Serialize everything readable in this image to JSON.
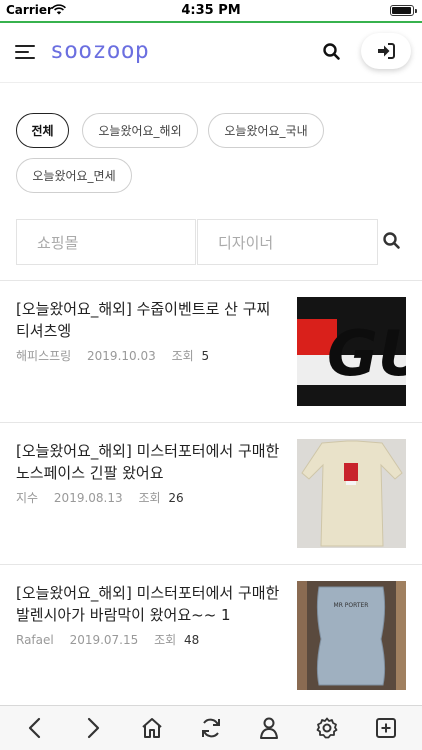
{
  "status": {
    "carrier": "Carrier",
    "time": "4:35 PM"
  },
  "header": {
    "logo": "soozoop"
  },
  "chips": [
    {
      "label": "전체",
      "active": true
    },
    {
      "label": "오늘왔어요_해외",
      "active": false
    },
    {
      "label": "오늘왔어요_국내",
      "active": false
    },
    {
      "label": "오늘왔어요_면세",
      "active": false
    }
  ],
  "search": {
    "shop_placeholder": "쇼핑몰",
    "designer_placeholder": "디자이너"
  },
  "posts": [
    {
      "title": "[오늘왔어요_해외] 수줍이벤트로 산 구찌티셔츠엥",
      "author": "해피스프링",
      "date": "2019.10.03",
      "views_label": "조회",
      "views": "5"
    },
    {
      "title": "[오늘왔어요_해외] 미스터포터에서 구매한 노스페이스 긴팔 왔어요",
      "author": "지수",
      "date": "2019.08.13",
      "views_label": "조회",
      "views": "26"
    },
    {
      "title": "[오늘왔어요_해외] 미스터포터에서 구매한 발렌시아가 바람막이 왔어요~~ 1",
      "author": "Rafael",
      "date": "2019.07.15",
      "views_label": "조회",
      "views": "48"
    }
  ],
  "thumb_text": {
    "mr_porter": "MR PORTER",
    "gu": "GU"
  },
  "colors": {
    "accent": "#6b6fe0",
    "progress": "#37b24d"
  },
  "toolbar": {
    "icons": [
      "back-icon",
      "forward-icon",
      "home-icon",
      "refresh-icon",
      "profile-icon",
      "settings-icon",
      "add-icon"
    ]
  }
}
